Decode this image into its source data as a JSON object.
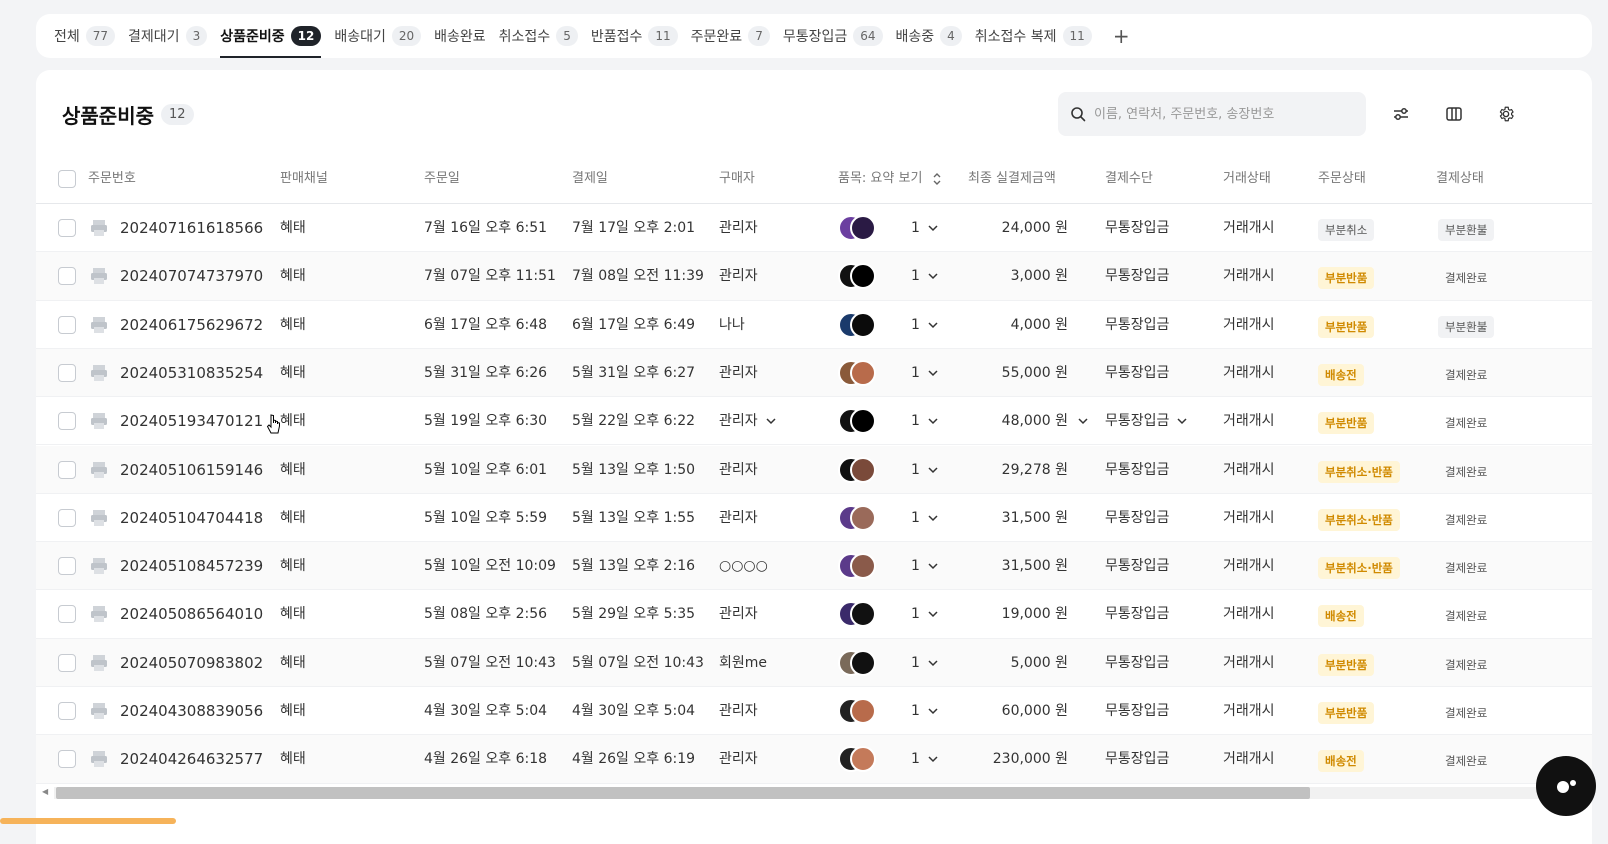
{
  "tabs": [
    {
      "label": "전체",
      "count": "77"
    },
    {
      "label": "결제대기",
      "count": "3"
    },
    {
      "label": "상품준비중",
      "count": "12",
      "active": true
    },
    {
      "label": "배송대기",
      "count": "20"
    },
    {
      "label": "배송완료",
      "count": ""
    },
    {
      "label": "취소접수",
      "count": "5"
    },
    {
      "label": "반품접수",
      "count": "11"
    },
    {
      "label": "주문완료",
      "count": "7"
    },
    {
      "label": "무통장입금",
      "count": "64"
    },
    {
      "label": "배송중",
      "count": "4"
    },
    {
      "label": "취소접수 복제",
      "count": "11"
    }
  ],
  "tab_add": "+",
  "header": {
    "title": "상품준비중",
    "count": "12"
  },
  "search": {
    "placeholder": "이름, 연락처, 주문번호, 송장번호"
  },
  "columns": {
    "order_no": "주문번호",
    "channel": "판매채널",
    "order_date": "주문일",
    "pay_date": "결제일",
    "buyer": "구매자",
    "items": "품목: 요약 보기",
    "amount": "최종 실결제금액",
    "method": "결제수단",
    "trade": "거래상태",
    "order_status": "주문상태",
    "pay_status": "결제상태"
  },
  "rows": [
    {
      "order_no": "202407161618566",
      "channel": "혜태",
      "order_date": "7월 16일 오후 6:51",
      "pay_date": "7월 17일 오후 2:01",
      "buyer": "관리자",
      "qty": "1",
      "amount": "24,000 원",
      "method": "무통장입금",
      "trade": "거래개시",
      "order_status": "부분취소",
      "pay_status": "부분환불"
    },
    {
      "order_no": "202407074737970",
      "channel": "혜태",
      "order_date": "7월 07일 오후 11:51",
      "pay_date": "7월 08일 오전 11:39",
      "buyer": "관리자",
      "qty": "1",
      "amount": "3,000 원",
      "method": "무통장입금",
      "trade": "거래개시",
      "order_status": "부분반품",
      "pay_status": "결제완료"
    },
    {
      "order_no": "202406175629672",
      "channel": "혜태",
      "order_date": "6월 17일 오후 6:48",
      "pay_date": "6월 17일 오후 6:49",
      "buyer": "나나",
      "qty": "1",
      "amount": "4,000 원",
      "method": "무통장입금",
      "trade": "거래개시",
      "order_status": "부분반품",
      "pay_status": "부분환불"
    },
    {
      "order_no": "202405310835254",
      "channel": "혜태",
      "order_date": "5월 31일 오후 6:26",
      "pay_date": "5월 31일 오후 6:27",
      "buyer": "관리자",
      "qty": "1",
      "amount": "55,000 원",
      "method": "무통장입금",
      "trade": "거래개시",
      "order_status": "배송전",
      "pay_status": "결제완료"
    },
    {
      "order_no": "202405193470121",
      "channel": "혜태",
      "order_date": "5월 19일 오후 6:30",
      "pay_date": "5월 22일 오후 6:22",
      "buyer": "관리자",
      "qty": "1",
      "amount": "48,000 원",
      "method": "무통장입금",
      "trade": "거래개시",
      "order_status": "부분반품",
      "pay_status": "결제완료"
    },
    {
      "order_no": "202405106159146",
      "channel": "혜태",
      "order_date": "5월 10일 오후 6:01",
      "pay_date": "5월 13일 오후 1:50",
      "buyer": "관리자",
      "qty": "1",
      "amount": "29,278 원",
      "method": "무통장입금",
      "trade": "거래개시",
      "order_status": "부분취소·반품",
      "pay_status": "결제완료"
    },
    {
      "order_no": "202405104704418",
      "channel": "혜태",
      "order_date": "5월 10일 오후 5:59",
      "pay_date": "5월 13일 오후 1:55",
      "buyer": "관리자",
      "qty": "1",
      "amount": "31,500 원",
      "method": "무통장입금",
      "trade": "거래개시",
      "order_status": "부분취소·반품",
      "pay_status": "결제완료"
    },
    {
      "order_no": "202405108457239",
      "channel": "혜태",
      "order_date": "5월 10일 오전 10:09",
      "pay_date": "5월 13일 오후 2:16",
      "buyer": "○○○○",
      "qty": "1",
      "amount": "31,500 원",
      "method": "무통장입금",
      "trade": "거래개시",
      "order_status": "부분취소·반품",
      "pay_status": "결제완료"
    },
    {
      "order_no": "202405086564010",
      "channel": "혜태",
      "order_date": "5월 08일 오후 2:56",
      "pay_date": "5월 29일 오후 5:35",
      "buyer": "관리자",
      "qty": "1",
      "amount": "19,000 원",
      "method": "무통장입금",
      "trade": "거래개시",
      "order_status": "배송전",
      "pay_status": "결제완료"
    },
    {
      "order_no": "202405070983802",
      "channel": "혜태",
      "order_date": "5월 07일 오전 10:43",
      "pay_date": "5월 07일 오전 10:43",
      "buyer": "회원me",
      "qty": "1",
      "amount": "5,000 원",
      "method": "무통장입금",
      "trade": "거래개시",
      "order_status": "부분반품",
      "pay_status": "결제완료"
    },
    {
      "order_no": "202404308839056",
      "channel": "혜태",
      "order_date": "4월 30일 오후 5:04",
      "pay_date": "4월 30일 오후 5:04",
      "buyer": "관리자",
      "qty": "1",
      "amount": "60,000 원",
      "method": "무통장입금",
      "trade": "거래개시",
      "order_status": "부분반품",
      "pay_status": "결제완료"
    },
    {
      "order_no": "202404264632577",
      "channel": "혜태",
      "order_date": "4월 26일 오후 6:18",
      "pay_date": "4월 26일 오후 6:19",
      "buyer": "관리자",
      "qty": "1",
      "amount": "230,000 원",
      "method": "무통장입금",
      "trade": "거래개시",
      "order_status": "배송전",
      "pay_status": "결제완료"
    }
  ],
  "colors": {
    "accent_dark": "#1f2329",
    "badge_yellow_text": "#d08a00",
    "badge_yellow_bg": "#fff5d6",
    "badge_gray_bg": "#f1f2f4"
  },
  "icons": {
    "search": "search-icon",
    "filter": "filter-sliders-icon",
    "columns": "columns-icon",
    "settings": "gear-icon",
    "print": "printer-icon"
  }
}
